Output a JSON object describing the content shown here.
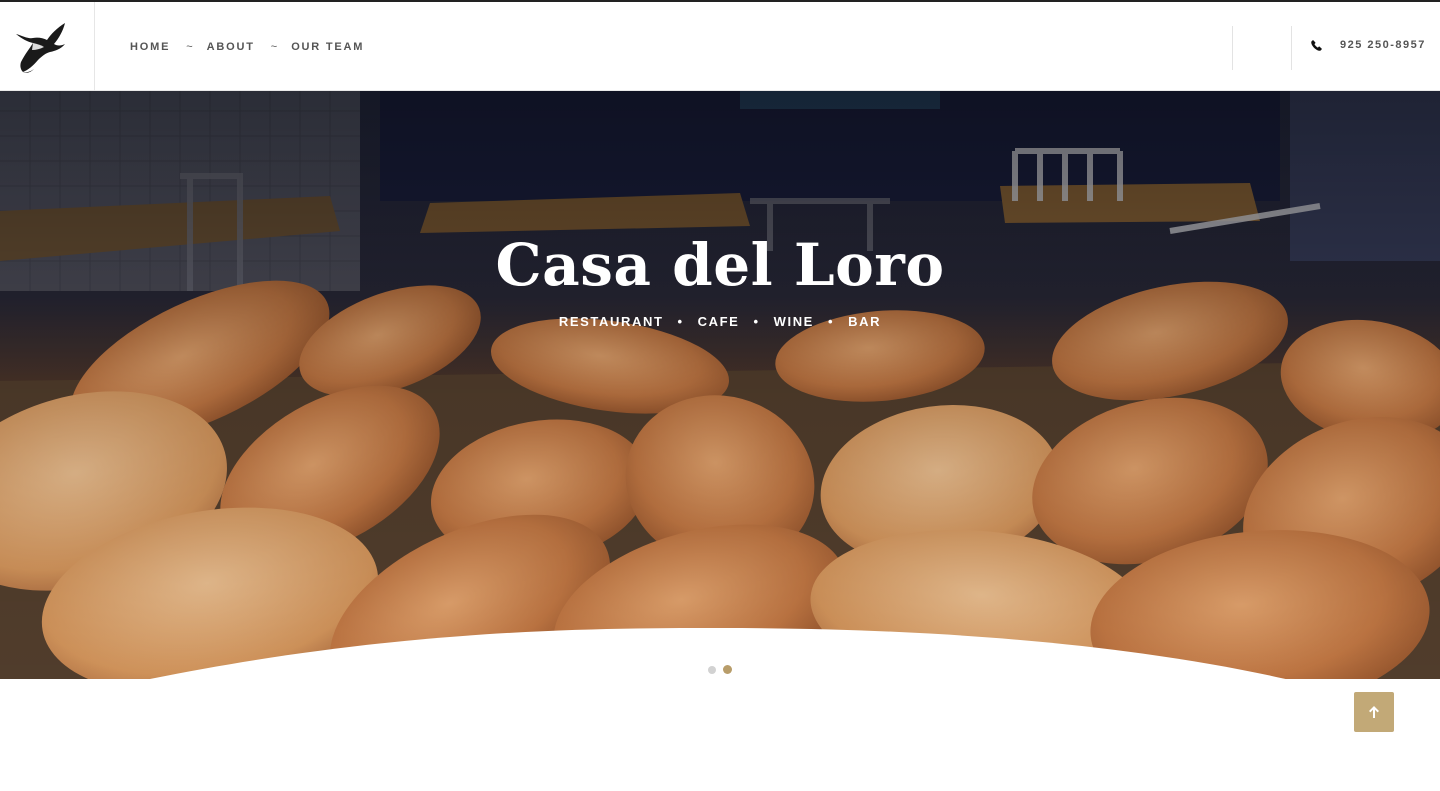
{
  "header": {
    "logo_icon": "bird-logo-icon",
    "nav": [
      {
        "label": "HOME"
      },
      {
        "label": "ABOUT"
      },
      {
        "label": "OUR TEAM"
      }
    ],
    "nav_separator": "~",
    "phone_icon": "phone-icon",
    "phone": "925 250-8957"
  },
  "hero": {
    "title": "Casa del Loro",
    "taglines": [
      "RESTAURANT",
      "CAFE",
      "WINE",
      "BAR"
    ],
    "tagline_separator": "•",
    "background": "fried empanadas on a tray in a restaurant",
    "slides": 2,
    "active_slide": 2
  },
  "back_to_top": {
    "icon": "arrow-up-icon"
  },
  "colors": {
    "accent": "#c2a977",
    "active_dot": "#b89d6a",
    "nav_text": "#555555",
    "hero_dark": "#1c1d2c"
  }
}
